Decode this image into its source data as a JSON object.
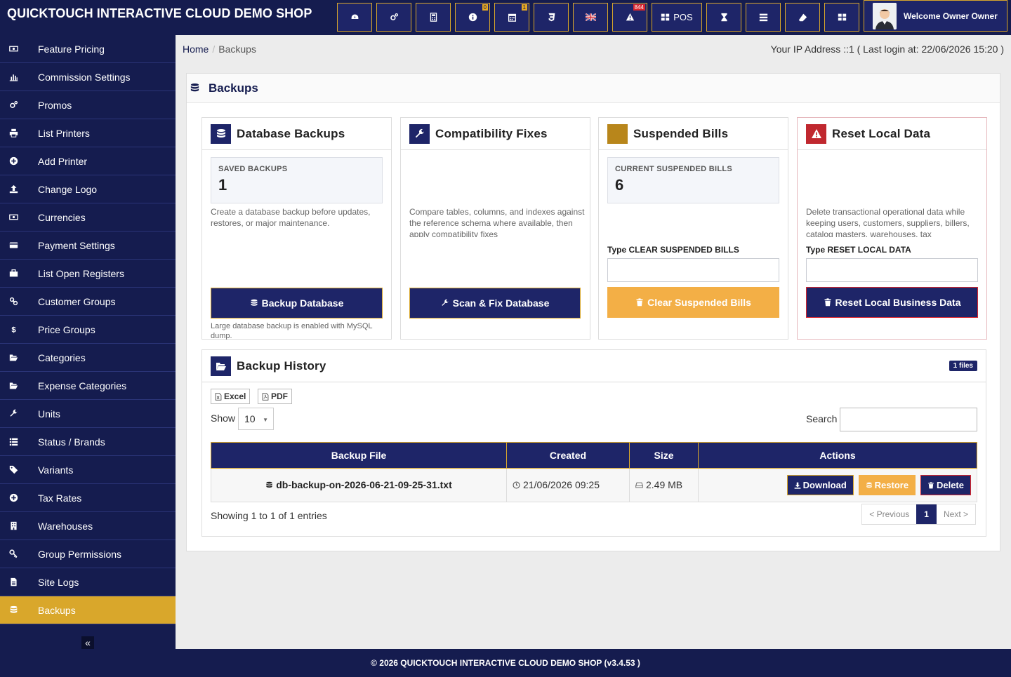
{
  "app": {
    "brand": "QUICKTOUCH INTERACTIVE CLOUD DEMO SHOP"
  },
  "topbar": {
    "buttons": [
      {
        "icon": "dashboard-icon"
      },
      {
        "icon": "cogs-icon"
      },
      {
        "icon": "calculator-icon"
      },
      {
        "icon": "info-icon",
        "badge": "0"
      },
      {
        "icon": "calendar-icon",
        "badge": "1"
      },
      {
        "icon": "css3-icon"
      },
      {
        "icon": "uk-flag-icon"
      },
      {
        "icon": "warning-icon",
        "badge": "844"
      },
      {
        "icon": "pos-grid-icon",
        "label": "POS"
      },
      {
        "icon": "hourglass-icon"
      },
      {
        "icon": "list-icon"
      },
      {
        "icon": "eraser-icon"
      },
      {
        "icon": "grid-icon"
      }
    ],
    "user_label": "Welcome Owner Owner"
  },
  "sidebar": {
    "items": [
      {
        "label": "Feature Pricing",
        "icon": "money-icon"
      },
      {
        "label": "Commission Settings",
        "icon": "bar-chart-icon"
      },
      {
        "label": "Promos",
        "icon": "cogs-icon"
      },
      {
        "label": "List Printers",
        "icon": "printer-icon"
      },
      {
        "label": "Add Printer",
        "icon": "plus-circle-icon"
      },
      {
        "label": "Change Logo",
        "icon": "upload-icon"
      },
      {
        "label": "Currencies",
        "icon": "money-icon"
      },
      {
        "label": "Payment Settings",
        "icon": "credit-card-icon"
      },
      {
        "label": "List Open Registers",
        "icon": "briefcase-icon"
      },
      {
        "label": "Customer Groups",
        "icon": "link-icon"
      },
      {
        "label": "Price Groups",
        "icon": "dollar-icon"
      },
      {
        "label": "Categories",
        "icon": "folder-open-icon"
      },
      {
        "label": "Expense Categories",
        "icon": "folder-open-icon"
      },
      {
        "label": "Units",
        "icon": "wrench-icon"
      },
      {
        "label": "Status / Brands",
        "icon": "th-list-icon"
      },
      {
        "label": "Variants",
        "icon": "tags-icon"
      },
      {
        "label": "Tax Rates",
        "icon": "plus-circle-icon"
      },
      {
        "label": "Warehouses",
        "icon": "building-icon"
      },
      {
        "label": "Group Permissions",
        "icon": "key-icon"
      },
      {
        "label": "Site Logs",
        "icon": "file-text-icon"
      },
      {
        "label": "Backups",
        "icon": "database-icon",
        "active": true
      }
    ],
    "collapse_glyph": "«"
  },
  "breadcrumb": {
    "home": "Home",
    "current": "Backups",
    "sep": "/"
  },
  "ip_info": "Your IP Address ::1 ( Last login at: 22/06/2026 15:20 )",
  "page": {
    "title": "Backups"
  },
  "cards": {
    "db": {
      "title": "Database Backups",
      "stat_label": "SAVED BACKUPS",
      "stat_value": "1",
      "desc": "Create a database backup before updates, restores, or major maintenance.",
      "button": "Backup Database",
      "note": "Large database backup is enabled with MySQL dump."
    },
    "compat": {
      "title": "Compatibility Fixes",
      "desc": "Compare tables, columns, and indexes against the reference schema where available, then apply compatibility fixes",
      "button": "Scan & Fix Database"
    },
    "suspended": {
      "title": "Suspended Bills",
      "stat_label": "CURRENT SUSPENDED BILLS",
      "stat_value": "6",
      "type_prefix": "Type",
      "type_phrase": "CLEAR SUSPENDED BILLS",
      "button": "Clear Suspended Bills"
    },
    "reset": {
      "title": "Reset Local Data",
      "desc": "Delete transactional operational data while keeping users, customers, suppliers, billers, catalog masters, warehouses, tax",
      "type_prefix": "Type",
      "type_phrase": "RESET LOCAL DATA",
      "button": "Reset Local Business Data"
    }
  },
  "history": {
    "title": "Backup History",
    "badge": "1 files",
    "export_excel": "Excel",
    "export_pdf": "PDF",
    "show_label": "Show",
    "page_size": "10",
    "search_label": "Search",
    "search_value": "",
    "columns": [
      "Backup File",
      "Created",
      "Size",
      "Actions"
    ],
    "rows": [
      {
        "file": "db-backup-on-2026-06-21-09-25-31.txt",
        "created": "21/06/2026 09:25",
        "size": "2.49 MB"
      }
    ],
    "actions": {
      "download": "Download",
      "restore": "Restore",
      "delete": "Delete"
    },
    "showing": "Showing 1 to 1 of 1 entries",
    "pager": {
      "prev": "< Previous",
      "current": "1",
      "next": "Next >"
    }
  },
  "footer": "© 2026 QUICKTOUCH INTERACTIVE CLOUD DEMO SHOP (v3.4.53 )",
  "colors": {
    "navy": "#151c4f",
    "navy_btn": "#1e2568",
    "gold": "#d9a72b",
    "orange": "#f3af46",
    "red": "#d9262e"
  }
}
